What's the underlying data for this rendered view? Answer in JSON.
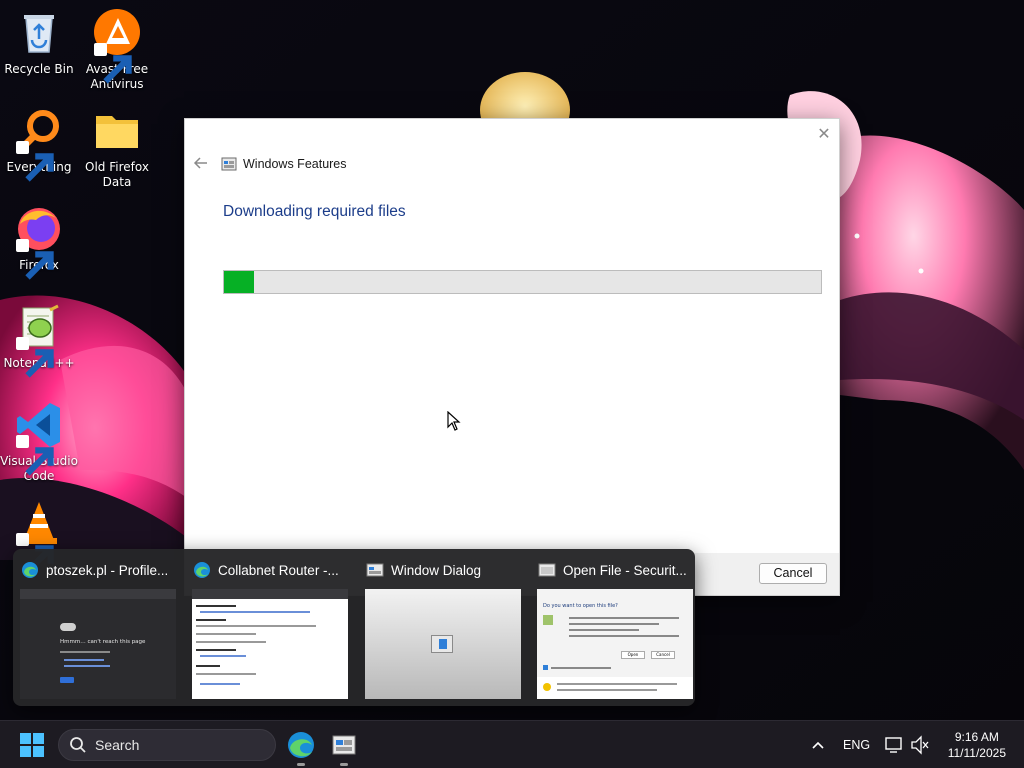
{
  "desktop": {
    "icons": [
      {
        "label": "Recycle Bin",
        "icon": "recycle-bin-icon"
      },
      {
        "label": "Avast Free Antivirus",
        "icon": "avast-icon"
      },
      {
        "label": "Everything",
        "icon": "everything-search-icon"
      },
      {
        "label": "Old Firefox Data",
        "icon": "folder-icon"
      },
      {
        "label": "Firefox",
        "icon": "firefox-icon"
      },
      {
        "label": "Notepad++",
        "icon": "notepadpp-icon"
      },
      {
        "label": "Visual Studio Code",
        "icon": "vscode-icon"
      },
      {
        "label": "",
        "icon": "vlc-icon"
      }
    ]
  },
  "dialog": {
    "title": "Windows Features",
    "heading": "Downloading required files",
    "progress_fraction": 0.05,
    "cancel_label": "Cancel",
    "close_glyph": "✕",
    "colors": {
      "heading": "#1c3d8a",
      "progress": "#06b025"
    }
  },
  "thumbnails": [
    {
      "title": "ptoszek.pl - Profile...",
      "icon": "edge-icon",
      "preview_heading": "Hmmm… can't reach this page"
    },
    {
      "title": "Collabnet Router -...",
      "icon": "edge-icon"
    },
    {
      "title": "Window Dialog",
      "icon": "window-dialog-icon"
    },
    {
      "title": "Open File - Securit...",
      "icon": "open-file-icon",
      "preview_heading": "Do you want to open this file?",
      "preview_buttons": [
        "Open",
        "Cancel"
      ]
    }
  ],
  "taskbar": {
    "search_label": "Search",
    "language": "ENG",
    "time": "9:16 AM",
    "date": "11/11/2025",
    "apps": [
      "edge-icon",
      "windows-features-icon"
    ]
  }
}
